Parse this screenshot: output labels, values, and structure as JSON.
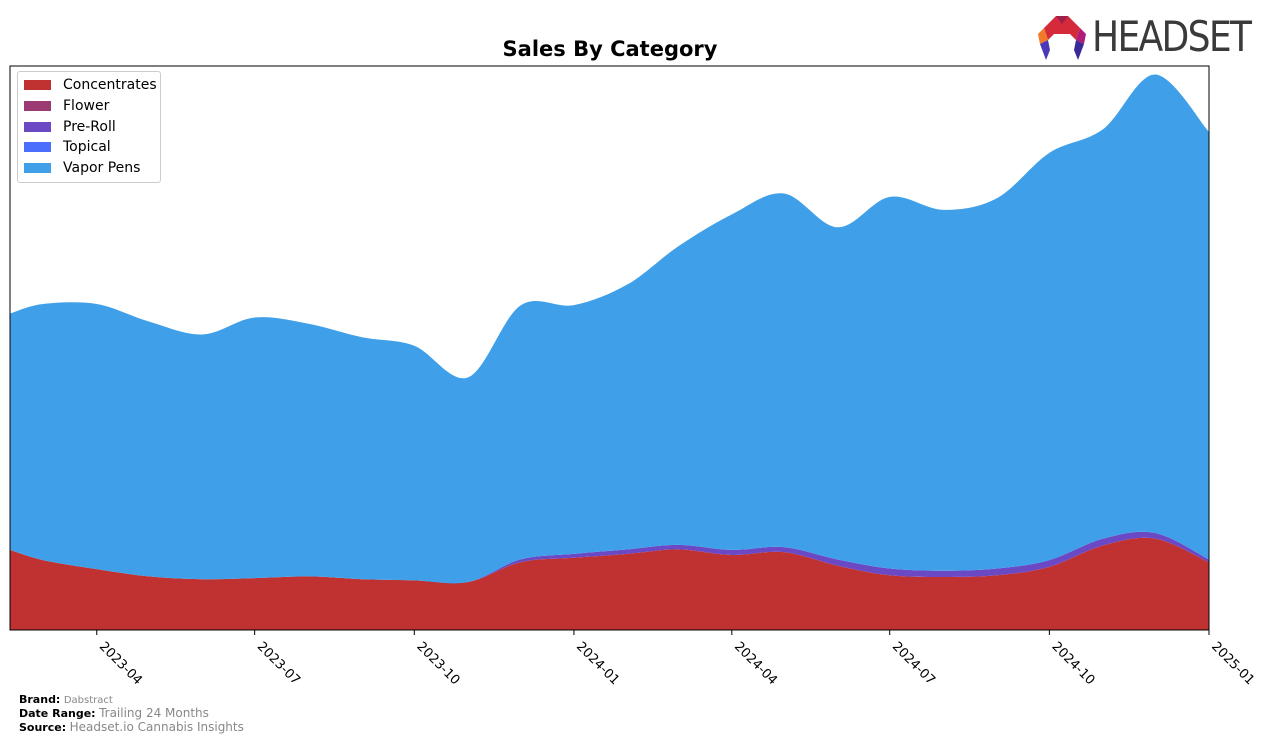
{
  "chart_data": {
    "type": "area",
    "stacked": true,
    "title": "Sales By Category",
    "xlabel": "",
    "ylabel": "",
    "y_ticks_shown": false,
    "y_units": "relative (0-100 of plot height)",
    "ylim": [
      0,
      100
    ],
    "x": [
      "2023-02",
      "2023-03",
      "2023-04",
      "2023-05",
      "2023-06",
      "2023-07",
      "2023-08",
      "2023-09",
      "2023-10",
      "2023-11",
      "2023-12",
      "2024-01",
      "2024-02",
      "2024-03",
      "2024-04",
      "2024-05",
      "2024-06",
      "2024-07",
      "2024-08",
      "2024-09",
      "2024-10",
      "2024-11",
      "2024-12",
      "2025-01"
    ],
    "x_ticks": [
      "2023-04",
      "2023-07",
      "2023-10",
      "2024-01",
      "2024-04",
      "2024-07",
      "2024-10",
      "2025-01"
    ],
    "xlim": [
      "2023-02-10",
      "2025-01-01"
    ],
    "series": [
      {
        "name": "Concentrates",
        "color": "#c03232",
        "values": [
          14.2,
          12.4,
          10.8,
          9.5,
          9.0,
          9.2,
          9.5,
          9.0,
          8.8,
          8.5,
          12.0,
          12.8,
          13.5,
          14.3,
          13.3,
          13.8,
          11.4,
          9.7,
          9.4,
          9.7,
          11.2,
          15.0,
          16.2,
          12.0
        ]
      },
      {
        "name": "Flower",
        "color": "#9b3a73",
        "values": [
          0,
          0,
          0,
          0,
          0,
          0,
          0,
          0,
          0,
          0,
          0,
          0,
          0,
          0,
          0,
          0,
          0,
          0,
          0,
          0,
          0,
          0,
          0,
          0
        ]
      },
      {
        "name": "Pre-Roll",
        "color": "#6b48c4",
        "values": [
          0,
          0,
          0,
          0,
          0,
          0,
          0,
          0,
          0,
          0,
          0.5,
          0.7,
          0.8,
          0.8,
          0.9,
          0.9,
          1.1,
          1.2,
          1.1,
          1.2,
          1.2,
          1.2,
          1.0,
          0.5
        ]
      },
      {
        "name": "Topical",
        "color": "#4b6ffa",
        "values": [
          0,
          0,
          0,
          0,
          0,
          0,
          0,
          0,
          0,
          0,
          0,
          0,
          0,
          0,
          0,
          0,
          0,
          0,
          0,
          0,
          0,
          0,
          0,
          0
        ]
      },
      {
        "name": "Vapor Pens",
        "color": "#3fa0e9",
        "values": [
          41.9,
          45.4,
          47.0,
          45.2,
          43.4,
          46.2,
          44.8,
          42.9,
          41.6,
          36.3,
          45.0,
          44.1,
          47.0,
          52.9,
          59.5,
          62.7,
          58.9,
          65.9,
          64.0,
          65.7,
          72.2,
          72.6,
          81.3,
          75.8
        ]
      }
    ],
    "legend": {
      "position": "top-left",
      "entries": [
        "Concentrates",
        "Flower",
        "Pre-Roll",
        "Topical",
        "Vapor Pens"
      ]
    }
  },
  "logo": {
    "text": "HEADSET"
  },
  "footer": {
    "brand_label": "Brand:",
    "brand_value": "Dabstract",
    "range_label": "Date Range:",
    "range_value": "Trailing 24 Months",
    "source_label": "Source:",
    "source_value": "Headset.io Cannabis Insights"
  }
}
